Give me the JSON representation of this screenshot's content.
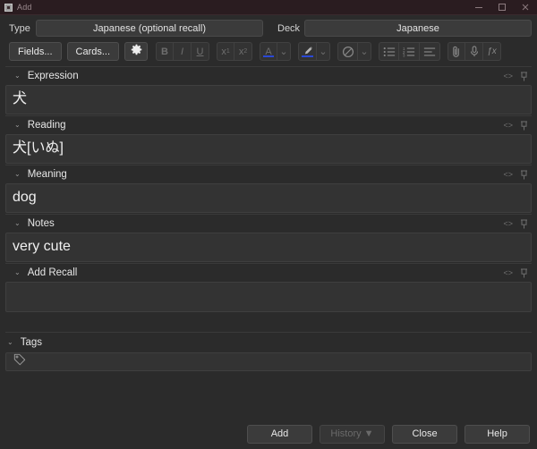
{
  "window": {
    "title": "Add",
    "controls": {
      "minimize": "—",
      "maximize": "❐",
      "close": "✕"
    }
  },
  "meta": {
    "type_label": "Type",
    "type_value": "Japanese (optional recall)",
    "deck_label": "Deck",
    "deck_value": "Japanese"
  },
  "toolbar": {
    "fields_label": "Fields...",
    "cards_label": "Cards...",
    "settings_icon": "gear-icon",
    "bold": "B",
    "italic": "I",
    "underline": "U",
    "superscript": "x",
    "superscript_mark": "1",
    "subscript": "x",
    "subscript_mark": "2",
    "text_color": "A",
    "chevron": "⌄",
    "highlight_icon": "highlighter-icon",
    "eraser_icon": "eraser-icon",
    "bullet_list_icon": "unordered-list-icon",
    "numbered_list_icon": "ordered-list-icon",
    "align_icon": "text-align-icon",
    "attach_icon": "paperclip-icon",
    "record_icon": "microphone-icon",
    "equation_label": "ƒx"
  },
  "field_icons": {
    "collapse": "⌄",
    "html_editor": "<>",
    "pin": "pin-icon"
  },
  "fields": [
    {
      "name": "Expression",
      "value": "犬"
    },
    {
      "name": "Reading",
      "value": "犬[いぬ]"
    },
    {
      "name": "Meaning",
      "value": "dog"
    },
    {
      "name": "Notes",
      "value": "very cute"
    },
    {
      "name": "Add Recall",
      "value": ""
    }
  ],
  "tags": {
    "label": "Tags",
    "icon": "tag-icon",
    "value": ""
  },
  "footer": {
    "add": "Add",
    "history": "History ▼",
    "close": "Close",
    "help": "Help"
  },
  "colors": {
    "accent_blue": "#2b49d6",
    "titlebar_bg": "#2a1c20",
    "window_bg": "#2b2b2b",
    "input_bg": "#333333"
  }
}
